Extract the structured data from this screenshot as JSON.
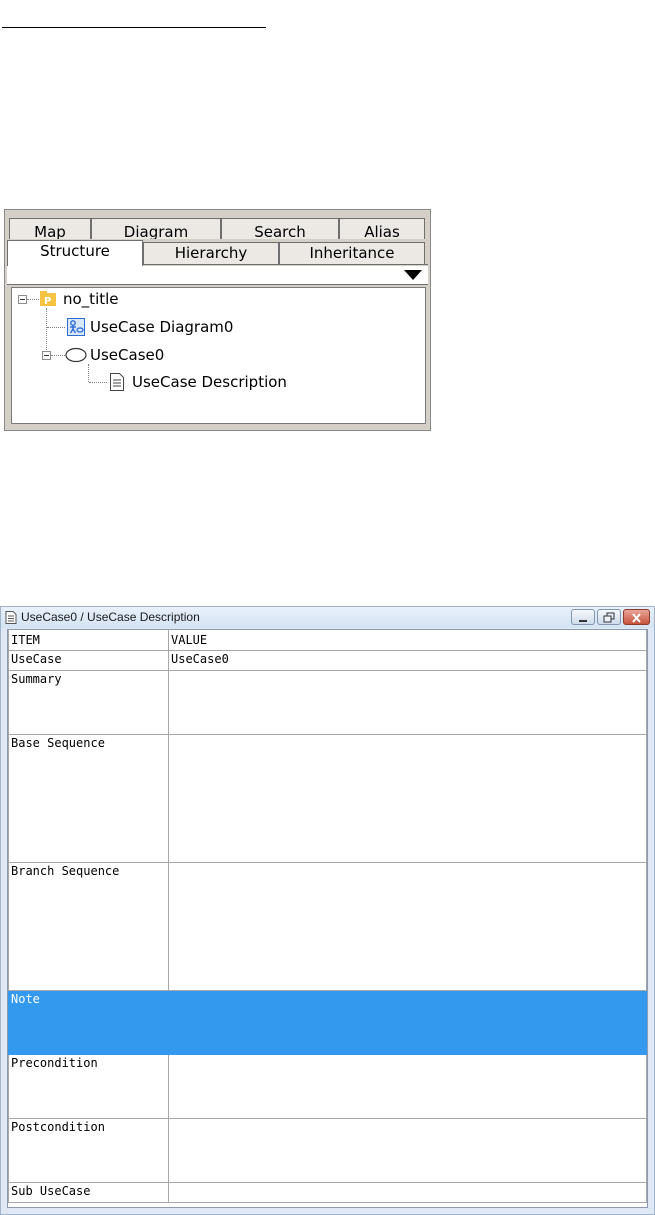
{
  "tree_panel": {
    "tabs_back": [
      "Map",
      "Diagram",
      "Search",
      "Alias"
    ],
    "tabs_front": [
      "Structure",
      "Hierarchy",
      "Inheritance"
    ],
    "active_tab": "Structure",
    "tree": {
      "root": "no_title",
      "diagram": "UseCase Diagram0",
      "usecase": "UseCase0",
      "description": "UseCase Description"
    }
  },
  "description_window": {
    "title": "UseCase0 / UseCase Description",
    "columns": [
      "ITEM",
      "VALUE"
    ],
    "rows": [
      {
        "item": "UseCase",
        "value": "UseCase0"
      },
      {
        "item": "Summary",
        "value": ""
      },
      {
        "item": "Base Sequence",
        "value": ""
      },
      {
        "item": "Branch Sequence",
        "value": ""
      },
      {
        "item": "Note",
        "value": "",
        "selected": true
      },
      {
        "item": "Precondition",
        "value": ""
      },
      {
        "item": "Postcondition",
        "value": ""
      },
      {
        "item": "Sub UseCase",
        "value": ""
      }
    ]
  },
  "colors": {
    "selection": "#3399ee",
    "panel": "#d4d0c8",
    "folder_icon": "#f5c242",
    "diagram_icon": "#2b6cd4"
  },
  "icons": {
    "root": "package-folder-icon",
    "diagram": "usecase-diagram-icon",
    "usecase": "usecase-ellipse-icon",
    "description": "document-icon"
  }
}
